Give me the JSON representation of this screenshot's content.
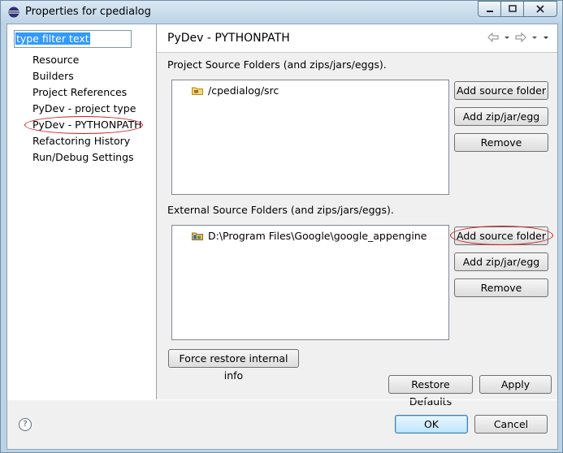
{
  "window": {
    "title": "Properties for cpedialog",
    "minimize": "0",
    "maximize": "1",
    "close": "r"
  },
  "sidebar": {
    "filter_text": "type filter text",
    "items": [
      {
        "label": "Resource"
      },
      {
        "label": "Builders"
      },
      {
        "label": "Project References"
      },
      {
        "label": "PyDev - project type"
      },
      {
        "label": "PyDev - PYTHONPATH"
      },
      {
        "label": "Refactoring History"
      },
      {
        "label": "Run/Debug Settings"
      }
    ]
  },
  "page": {
    "title": "PyDev - PYTHONPATH",
    "project_section": {
      "label": "Project Source Folders (and zips/jars/eggs).",
      "items": [
        {
          "label": "/cpedialog/src"
        }
      ],
      "buttons": {
        "add_source": "Add source folder",
        "add_zip": "Add zip/jar/egg",
        "remove": "Remove"
      }
    },
    "external_section": {
      "label": "External Source Folders (and zips/jars/eggs).",
      "items": [
        {
          "label": "D:\\Program Files\\Google\\google_appengine"
        }
      ],
      "buttons": {
        "add_source": "Add source folder",
        "add_zip": "Add zip/jar/egg",
        "remove": "Remove"
      }
    },
    "force_restore": "Force restore internal info",
    "restore_defaults": "Restore Defaults",
    "apply": "Apply"
  },
  "footer": {
    "help": "?",
    "ok": "OK",
    "cancel": "Cancel"
  },
  "colors": {
    "highlight_oval": "#cc1a1a",
    "selection": "#3399ff",
    "window_frame": "#bcd3e6"
  }
}
